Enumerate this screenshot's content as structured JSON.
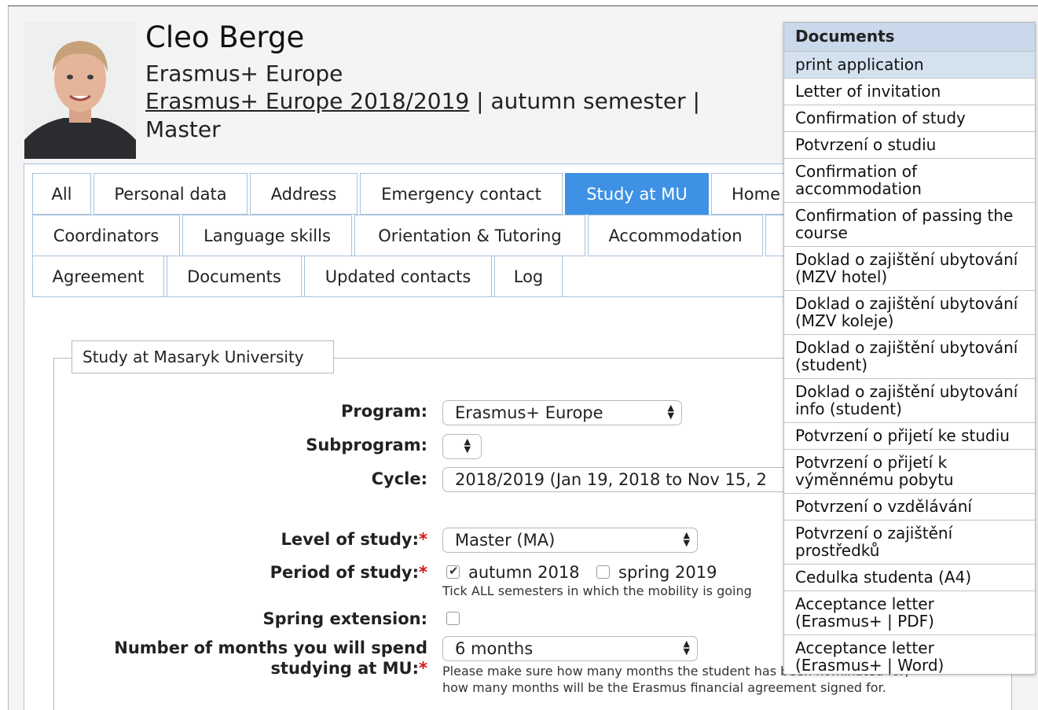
{
  "profile": {
    "name": "Cleo Berge",
    "program": "Erasmus+ Europe",
    "program_period_link": "Erasmus+ Europe 2018/2019",
    "semester": " | autumn semester |",
    "level": "Master"
  },
  "tabs": {
    "row1": [
      "All",
      "Personal data",
      "Address",
      "Emergency contact",
      "Study at MU",
      "Home"
    ],
    "row2": [
      "Coordinators",
      "Language skills",
      "Orientation & Tutoring",
      "Accommodation"
    ],
    "row3": [
      "Agreement",
      "Documents",
      "Updated contacts",
      "Log"
    ],
    "active": "Study at MU"
  },
  "form": {
    "legend": "Study at Masaryk University",
    "program_label": "Program:",
    "program_value": "Erasmus+ Europe",
    "subprogram_label": "Subprogram:",
    "subprogram_value": "",
    "cycle_label": "Cycle:",
    "cycle_value": "2018/2019 (Jan 19, 2018 to Nov 15, 2",
    "level_label": "Level of study:",
    "level_value": "Master (MA)",
    "period_label": "Period of study:",
    "period_autumn": "autumn 2018",
    "period_autumn_checked": true,
    "period_spring": "spring 2019",
    "period_spring_checked": false,
    "period_hint": "Tick ALL semesters in which the mobility is going",
    "spring_ext_label": "Spring extension:",
    "spring_ext_checked": false,
    "months_label_line1": "Number of months you will spend",
    "months_label_line2": "studying at MU:",
    "months_value": "6 months",
    "months_hint_line1": "Please make sure how many months the student has been nominated for,",
    "months_hint_line2": "how many months will be the Erasmus financial agreement signed for.",
    "required_mark": "*"
  },
  "documents_menu": {
    "title": "Documents",
    "items": [
      "print application",
      "Letter of invitation",
      "Confirmation of study",
      "Potvrzení o studiu",
      "Confirmation of\naccommodation",
      "Confirmation of passing the\ncourse",
      "Doklad o zajištění ubytování\n(MZV hotel)",
      "Doklad o zajištění ubytování\n(MZV koleje)",
      "Doklad o zajištění ubytování\n(student)",
      "Doklad o zajištění ubytování\ninfo (student)",
      "Potvrzení o přijetí ke studiu",
      "Potvrzení o přijetí k\nvýměnnému pobytu",
      "Potvrzení o vzdělávání",
      "Potvrzení o zajištění\nprostředků",
      "Cedulka studenta (A4)",
      "Acceptance letter\n(Erasmus+ | PDF)",
      "Acceptance letter\n(Erasmus+ | Word)"
    ],
    "highlighted": "print application"
  },
  "colors": {
    "active_tab": "#3e91e4",
    "menu_header": "#c9d8ea",
    "menu_highlight": "#d4e2f0",
    "required": "#d31616"
  }
}
